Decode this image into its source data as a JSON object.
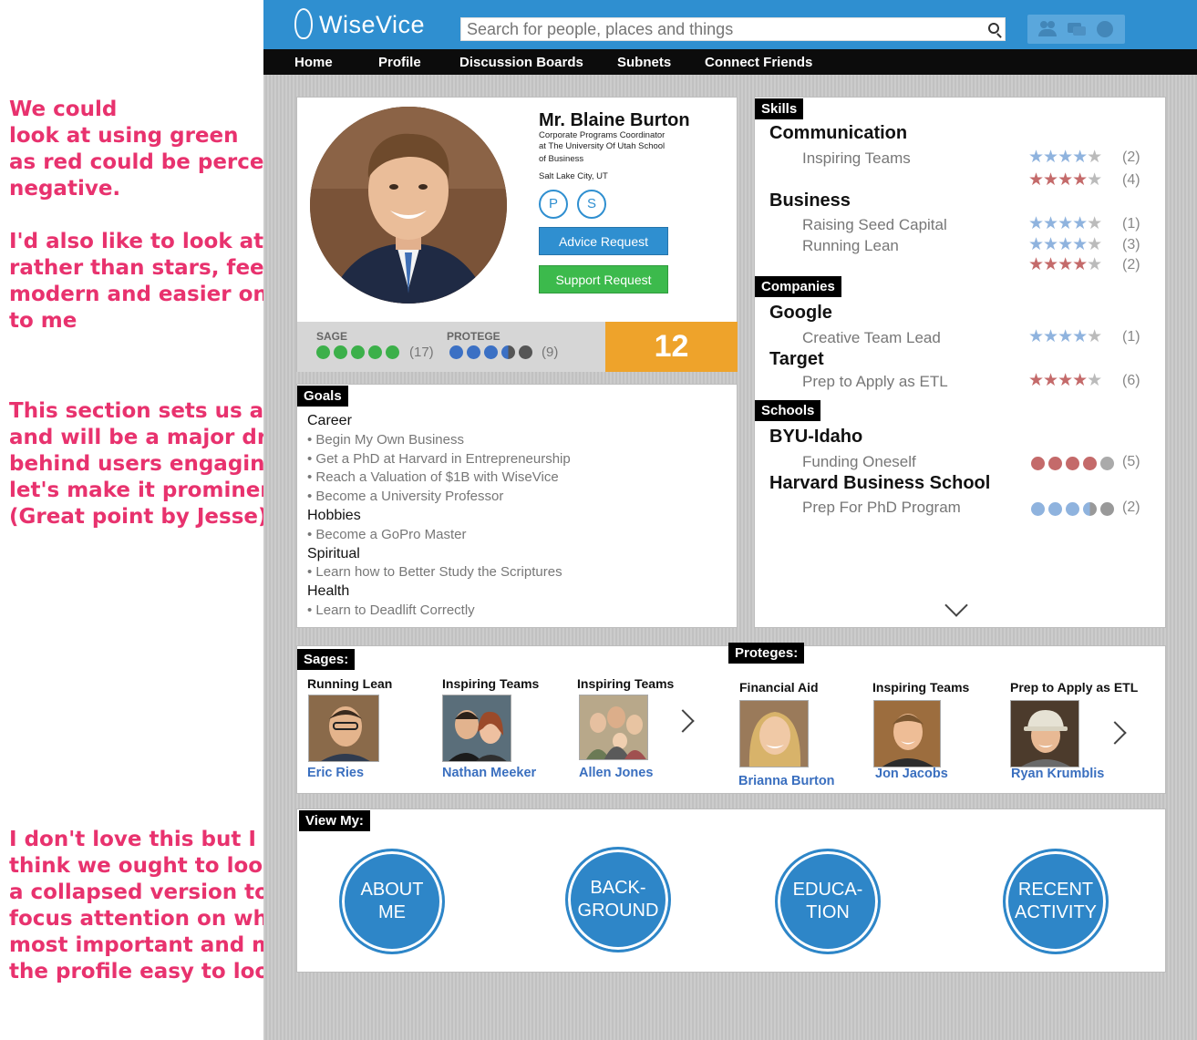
{
  "annotations": {
    "note1": "We could\nlook at using green\nas red could be perceived as\nnegative.\n\nI'd also like to look at circles\nrather than stars, feels more\nmodern and easier on the eyes\nto me",
    "note2": "This section sets us apart\nand will be a major driver\nbehind users engaging,\nlet's make it prominent.\n(Great point by Jesse)",
    "note3": "I don't love this but I\nthink we ought to look at\na collapsed version to\nfocus attention on whats\nmost important and make\nthe profile easy to look at"
  },
  "header": {
    "logo": "WiseVice",
    "search_placeholder": "Search for people, places and things",
    "icons": [
      "friends-icon",
      "messages-icon",
      "globe-icon"
    ]
  },
  "nav": [
    "Home",
    "Profile",
    "Discussion Boards",
    "Subnets",
    "Connect Friends"
  ],
  "profile": {
    "name": "Mr. Blaine Burton",
    "title": "Corporate Programs Coordinator",
    "org_line1": "at The University Of Utah School",
    "org_line2": "of Business",
    "location": "Salt Lake City, UT",
    "badge_p": "P",
    "badge_s": "S",
    "advice_btn": "Advice Request",
    "support_btn": "Support Request",
    "sage_label": "SAGE",
    "sage_count": "(17)",
    "sage_level": 5,
    "protege_label": "PROTEGE",
    "protege_count": "(9)",
    "protege_level": 3.5,
    "score": "12"
  },
  "goals": {
    "tag": "Goals",
    "sections": [
      {
        "category": "Career",
        "items": [
          "Begin My Own Business",
          "Get a PhD at Harvard in Entrepreneurship",
          "Reach a Valuation of $1B with WiseVice",
          "Become a University Professor"
        ]
      },
      {
        "category": "Hobbies",
        "items": [
          "Become a GoPro Master"
        ]
      },
      {
        "category": "Spiritual",
        "items": [
          "Learn how to Better Study the Scriptures"
        ]
      },
      {
        "category": "Health",
        "items": [
          "Learn to Deadlift Correctly"
        ]
      }
    ]
  },
  "skills": {
    "tag": "Skills",
    "groups": [
      {
        "heading": "Communication",
        "rows": [
          {
            "label": "Inspiring Teams",
            "color": "blue",
            "rating": 4,
            "count": "(2)"
          },
          {
            "label": "",
            "color": "red",
            "rating": 4,
            "count": "(4)"
          }
        ]
      },
      {
        "heading": "Business",
        "rows": [
          {
            "label": "Raising Seed Capital",
            "color": "blue",
            "rating": 4,
            "count": "(1)"
          },
          {
            "label": "Running Lean",
            "color": "blue",
            "rating": 4,
            "count": "(3)"
          },
          {
            "label": "",
            "color": "red",
            "rating": 4,
            "count": "(2)"
          }
        ]
      }
    ]
  },
  "companies": {
    "tag": "Companies",
    "groups": [
      {
        "heading": "Google",
        "rows": [
          {
            "label": "Creative Team Lead",
            "color": "blue",
            "rating": 4,
            "count": "(1)"
          }
        ]
      },
      {
        "heading": "Target",
        "rows": [
          {
            "label": "Prep to Apply as ETL",
            "color": "red",
            "rating": 4,
            "count": "(6)"
          }
        ]
      }
    ]
  },
  "schools": {
    "tag": "Schools",
    "groups": [
      {
        "heading": "BYU-Idaho",
        "rows": [
          {
            "label": "Funding Oneself",
            "color": "red",
            "rating": 4,
            "count": "(5)"
          }
        ]
      },
      {
        "heading": "Harvard Business School",
        "rows": [
          {
            "label": "Prep For PhD Program",
            "color": "blue",
            "rating": 3.5,
            "count": "(2)"
          }
        ]
      }
    ]
  },
  "sages": {
    "tag": "Sages:",
    "people": [
      {
        "topic": "Running Lean",
        "name": "Eric Ries"
      },
      {
        "topic": "Inspiring Teams",
        "name": "Nathan Meeker"
      },
      {
        "topic": "Inspiring Teams",
        "name": "Allen Jones"
      }
    ]
  },
  "proteges": {
    "tag": "Proteges:",
    "people": [
      {
        "topic": "Financial Aid",
        "name": "Brianna Burton"
      },
      {
        "topic": "Inspiring Teams",
        "name": "Jon Jacobs"
      },
      {
        "topic": "Prep to Apply as ETL",
        "name": "Ryan Krumblis"
      }
    ]
  },
  "view_my": {
    "tag": "View My:",
    "items": [
      "ABOUT\nME",
      "BACK-\nGROUND",
      "EDUCA-\nTION",
      "RECENT\nACTIVITY"
    ]
  }
}
